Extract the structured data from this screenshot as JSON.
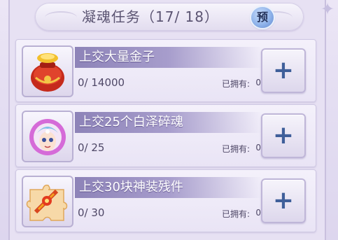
{
  "header": {
    "title": "凝魂任务（17/ 18）",
    "preview_label": "预"
  },
  "tasks": [
    {
      "title": "上交大量金子",
      "progress": "0/ 14000",
      "owned_label": "已拥有:",
      "owned_value": "0",
      "icon": "gold-pouch-icon",
      "add_label": "+"
    },
    {
      "title": "上交25个白泽碎魂",
      "progress": "0/ 25",
      "owned_label": "已拥有:",
      "owned_value": "0",
      "icon": "baize-soul-icon",
      "add_label": "+"
    },
    {
      "title": "上交30块神装残件",
      "progress": "0/ 30",
      "owned_label": "已拥有:",
      "owned_value": "0",
      "icon": "divine-gear-fragment-icon",
      "add_label": "+"
    }
  ],
  "colors": {
    "title_bar_text": "#5b5472",
    "task_title_band": "#8d83b8",
    "plus_color": "#3f5f9a",
    "preview_button": "#8fb3ea"
  }
}
